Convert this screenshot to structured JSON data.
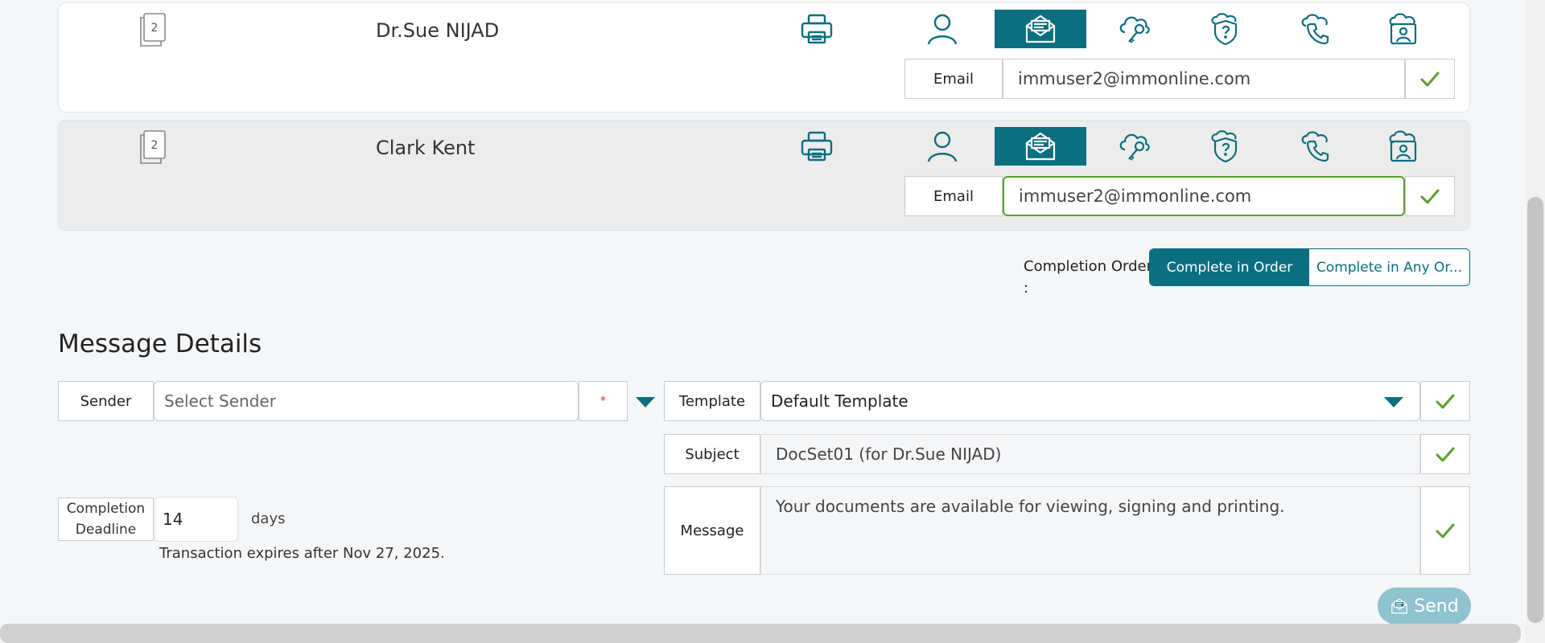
{
  "recipients": [
    {
      "doc_count": "2",
      "name": "Dr.Sue NIJAD",
      "email_label": "Email",
      "email": "immuser2@immonline.com"
    },
    {
      "doc_count": "2",
      "name": "Clark Kent",
      "email_label": "Email",
      "email": "immuser2@immonline.com"
    }
  ],
  "completion_order": {
    "label": "Completion Order :",
    "options": [
      "Complete in Order",
      "Complete in Any Or..."
    ],
    "selected": "Complete in Order"
  },
  "message_details": {
    "title": "Message Details",
    "sender_label": "Sender",
    "sender_placeholder": "Select Sender",
    "required_mark": "*",
    "template_label": "Template",
    "template_value": "Default Template",
    "subject_label": "Subject",
    "subject_value": "DocSet01 (for Dr.Sue NIJAD)",
    "message_label": "Message",
    "message_value": "Your documents are available for viewing, signing and printing.",
    "deadline_label": "Completion Deadline",
    "deadline_value": "14",
    "deadline_unit": "days",
    "expiry_text": "Transaction expires after Nov 27, 2025."
  },
  "send_label": "Send",
  "colors": {
    "accent": "#0b6f80",
    "check": "#5aa02c",
    "focus": "#5aa02c"
  },
  "icons": [
    "documents-icon",
    "print-icon",
    "user-icon",
    "email-icon",
    "cloud-key-icon",
    "shield-question-icon",
    "phone-icon",
    "id-card-icon",
    "check-icon",
    "caret-down-icon"
  ]
}
